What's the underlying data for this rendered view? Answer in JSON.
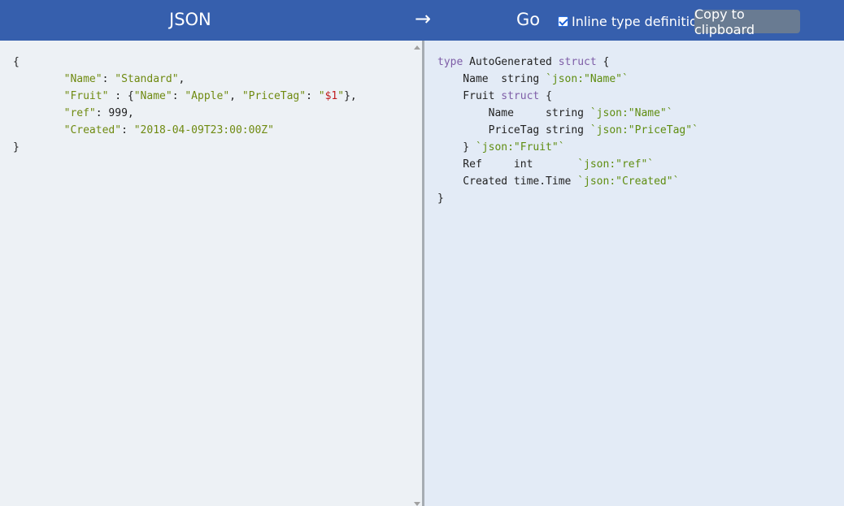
{
  "header": {
    "left_title": "JSON",
    "arrow": "→",
    "right_title": "Go",
    "inline_label": "Inline type definitions",
    "inline_checked": true,
    "copy_label": "Copy to clipboard"
  },
  "json_lines": [
    [
      {
        "t": "{",
        "c": "plain"
      }
    ],
    [
      {
        "t": "        ",
        "c": "plain"
      },
      {
        "t": "\"Name\"",
        "c": "key"
      },
      {
        "t": ": ",
        "c": "plain"
      },
      {
        "t": "\"Standard\"",
        "c": "str"
      },
      {
        "t": ",",
        "c": "plain"
      }
    ],
    [
      {
        "t": "        ",
        "c": "plain"
      },
      {
        "t": "\"Fruit\"",
        "c": "key"
      },
      {
        "t": " : {",
        "c": "plain"
      },
      {
        "t": "\"Name\"",
        "c": "key"
      },
      {
        "t": ": ",
        "c": "plain"
      },
      {
        "t": "\"Apple\"",
        "c": "str"
      },
      {
        "t": ", ",
        "c": "plain"
      },
      {
        "t": "\"PriceTag\"",
        "c": "key"
      },
      {
        "t": ": ",
        "c": "plain"
      },
      {
        "t": "\"",
        "c": "str"
      },
      {
        "t": "$1",
        "c": "dollar"
      },
      {
        "t": "\"",
        "c": "str"
      },
      {
        "t": "},",
        "c": "plain"
      }
    ],
    [
      {
        "t": "        ",
        "c": "plain"
      },
      {
        "t": "\"ref\"",
        "c": "key"
      },
      {
        "t": ": 999,",
        "c": "plain"
      }
    ],
    [
      {
        "t": "        ",
        "c": "plain"
      },
      {
        "t": "\"Created\"",
        "c": "key"
      },
      {
        "t": ": ",
        "c": "plain"
      },
      {
        "t": "\"2018-04-09T23:00:00Z\"",
        "c": "str"
      }
    ],
    [
      {
        "t": "}",
        "c": "plain"
      }
    ]
  ],
  "go_lines": [
    [
      {
        "t": "type",
        "c": "kw"
      },
      {
        "t": " AutoGenerated ",
        "c": "plain"
      },
      {
        "t": "struct",
        "c": "kw"
      },
      {
        "t": " {",
        "c": "plain"
      }
    ],
    [
      {
        "t": "    Name  string ",
        "c": "plain"
      },
      {
        "t": "`json:\"Name\"`",
        "c": "tag"
      }
    ],
    [
      {
        "t": "    Fruit ",
        "c": "plain"
      },
      {
        "t": "struct",
        "c": "kw"
      },
      {
        "t": " {",
        "c": "plain"
      }
    ],
    [
      {
        "t": "        Name     string ",
        "c": "plain"
      },
      {
        "t": "`json:\"Name\"`",
        "c": "tag"
      }
    ],
    [
      {
        "t": "        PriceTag string ",
        "c": "plain"
      },
      {
        "t": "`json:\"PriceTag\"`",
        "c": "tag"
      }
    ],
    [
      {
        "t": "    } ",
        "c": "plain"
      },
      {
        "t": "`json:\"Fruit\"`",
        "c": "tag"
      }
    ],
    [
      {
        "t": "    Ref     int       ",
        "c": "plain"
      },
      {
        "t": "`json:\"ref\"`",
        "c": "tag"
      }
    ],
    [
      {
        "t": "    Created time.Time ",
        "c": "plain"
      },
      {
        "t": "`json:\"Created\"`",
        "c": "tag"
      }
    ],
    [
      {
        "t": "}",
        "c": "plain"
      }
    ]
  ],
  "colors": {
    "header_bg": "#365fad",
    "left_pane_bg": "#edf1f5",
    "right_pane_bg": "#e3ebf6",
    "copy_button_bg": "#697b92"
  }
}
